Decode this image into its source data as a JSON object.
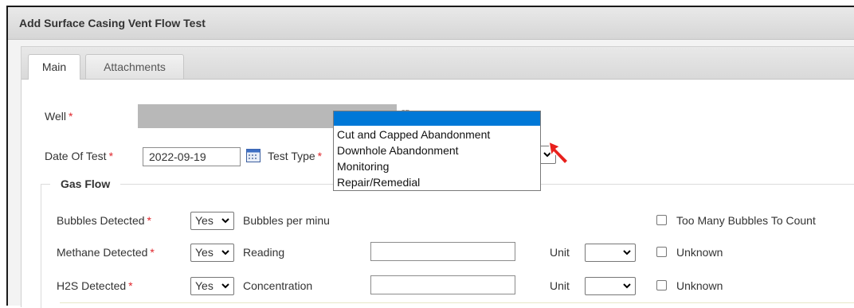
{
  "window": {
    "title": "Add Surface Casing Vent Flow Test"
  },
  "tabs": [
    {
      "label": "Main"
    },
    {
      "label": "Attachments"
    }
  ],
  "form": {
    "well_label": "Well",
    "required_mark": "*",
    "date_label": "Date Of Test",
    "date_value": "2022-09-19",
    "test_type_label": "Test Type",
    "test_type_value": ""
  },
  "gas_flow": {
    "legend": "Gas Flow",
    "bubbles_label": "Bubbles Detected",
    "bubbles_value": "Yes",
    "bubbles_per_minute_label": "Bubbles per minu",
    "too_many_label": "Too Many Bubbles To Count",
    "methane_label": "Methane Detected",
    "methane_value": "Yes",
    "reading_label": "Reading",
    "unit_label": "Unit",
    "unknown_label": "Unknown",
    "h2s_label": "H2S Detected",
    "h2s_value": "Yes",
    "concentration_label": "Concentration"
  },
  "dropdown": {
    "options": [
      "Cut and Capped Abandonment",
      "Downhole Abandonment",
      "Monitoring",
      "Repair/Remedial"
    ]
  },
  "colors": {
    "highlight": "#0078d7",
    "required": "#e0262c",
    "arrow": "#e8201c"
  },
  "icons": {
    "external_link": "external-link-icon",
    "calendar": "calendar-icon",
    "chevron": "chevron-down-icon",
    "pointer": "red-arrow-icon"
  }
}
